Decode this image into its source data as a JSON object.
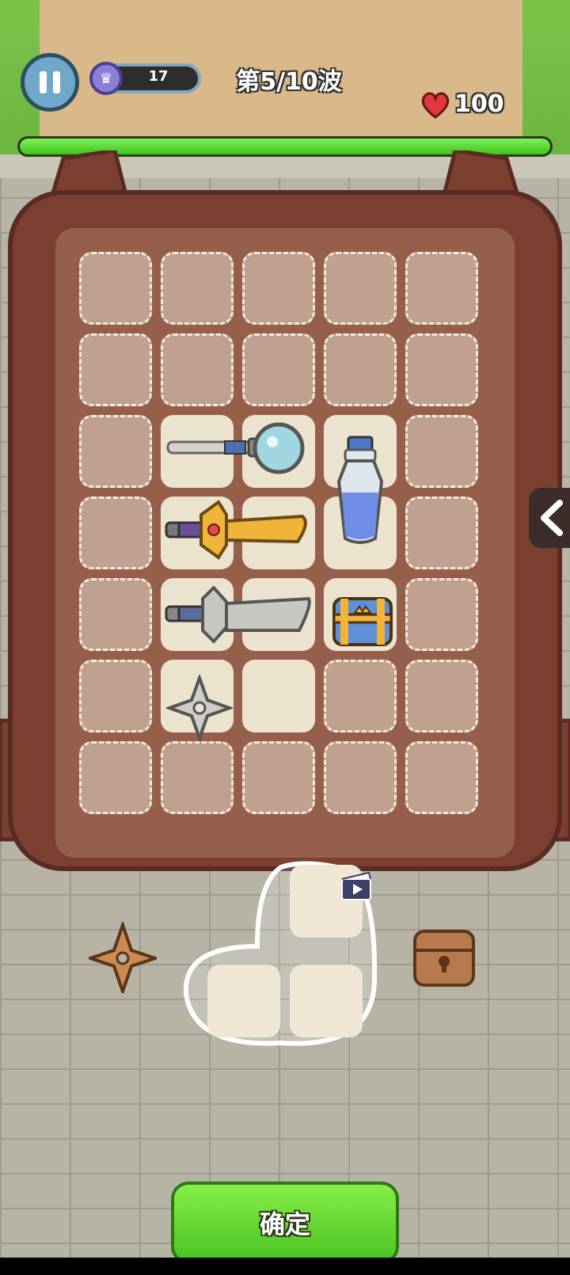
{
  "hud": {
    "crown_value": "17",
    "wave_label": "第5/10波",
    "hp_value": "100",
    "hp_fill_fraction": 1.0
  },
  "backpack": {
    "columns": 5,
    "rows": 7,
    "filled_cells": [
      [
        2,
        1
      ],
      [
        2,
        2
      ],
      [
        2,
        3
      ],
      [
        3,
        1
      ],
      [
        3,
        2
      ],
      [
        3,
        3
      ],
      [
        4,
        1
      ],
      [
        4,
        2
      ],
      [
        4,
        3
      ],
      [
        5,
        1
      ],
      [
        5,
        2
      ]
    ],
    "items": [
      {
        "name": "magnifier-wand-icon"
      },
      {
        "name": "blue-potion-icon"
      },
      {
        "name": "golden-sword-icon"
      },
      {
        "name": "silver-sword-icon"
      },
      {
        "name": "blue-treasure-chest-icon"
      },
      {
        "name": "silver-shuriken-icon"
      }
    ]
  },
  "tray": {
    "items": [
      {
        "name": "bronze-shuriken-icon"
      },
      {
        "name": "locked-chest-icon"
      },
      {
        "name": "video-ad-icon"
      }
    ]
  },
  "confirm_label": "确定",
  "colors": {
    "grass": "#7cc34a",
    "path": "#d9b88a",
    "backpack": "#7c4031",
    "confirm_green": "#5bd42a",
    "hp_green": "#4fd22a"
  }
}
